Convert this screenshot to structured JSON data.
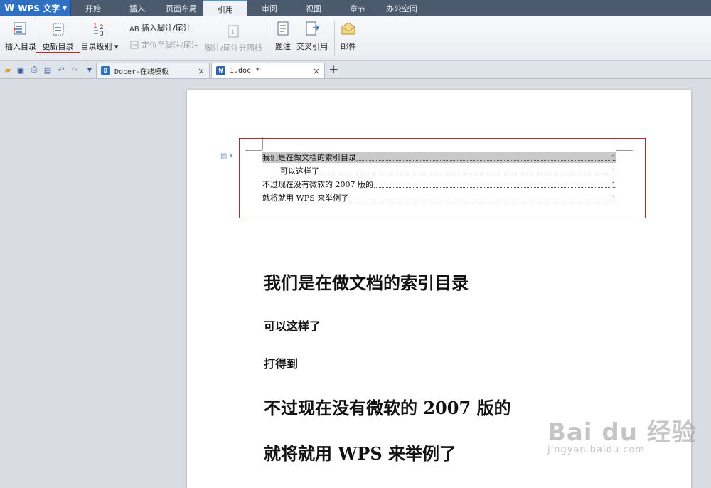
{
  "app": {
    "name": "WPS 文字",
    "logo": "W"
  },
  "menu": {
    "tabs": [
      "开始",
      "插入",
      "页面布局",
      "引用",
      "审阅",
      "视图",
      "章节",
      "办公空间"
    ],
    "active": "引用"
  },
  "ribbon": {
    "insert_toc": "插入目录",
    "update_toc": "更新目录",
    "toc_level": "目录级别",
    "insert_footnote": "插入脚注/尾注",
    "goto_footnote": "定位至脚注/尾注",
    "footnote_separator": "脚注/尾注分隔线",
    "caption": "题注",
    "cross_reference": "交叉引用",
    "mail": "邮件"
  },
  "tabs": {
    "docer": "Docer-在线模板",
    "doc": "1.doc *"
  },
  "toc": [
    {
      "text": "我们是在做文档的索引目录",
      "page": "1",
      "level": 1,
      "selected": true
    },
    {
      "text": "可以这样了",
      "page": "1",
      "level": 2,
      "selected": false
    },
    {
      "text": "不过现在没有微软的 2007 版的",
      "page": "1",
      "level": 1,
      "selected": false
    },
    {
      "text": "就将就用 WPS 来举例了",
      "page": "1",
      "level": 1,
      "selected": false
    }
  ],
  "body": {
    "h1_a": "我们是在做文档的索引目录",
    "h2_a": "可以这样了",
    "h2_b": "打得到",
    "h1_b": "不过现在没有微软的 2007 版的",
    "h1_c": "就将就用 WPS 来举例了"
  },
  "watermark": {
    "main": "Bai du 经验",
    "sub": "jingyan.baidu.com"
  },
  "colors": {
    "menubar": "#4c5a6e",
    "app_button": "#2f6fc4",
    "highlight": "#c8201f"
  }
}
